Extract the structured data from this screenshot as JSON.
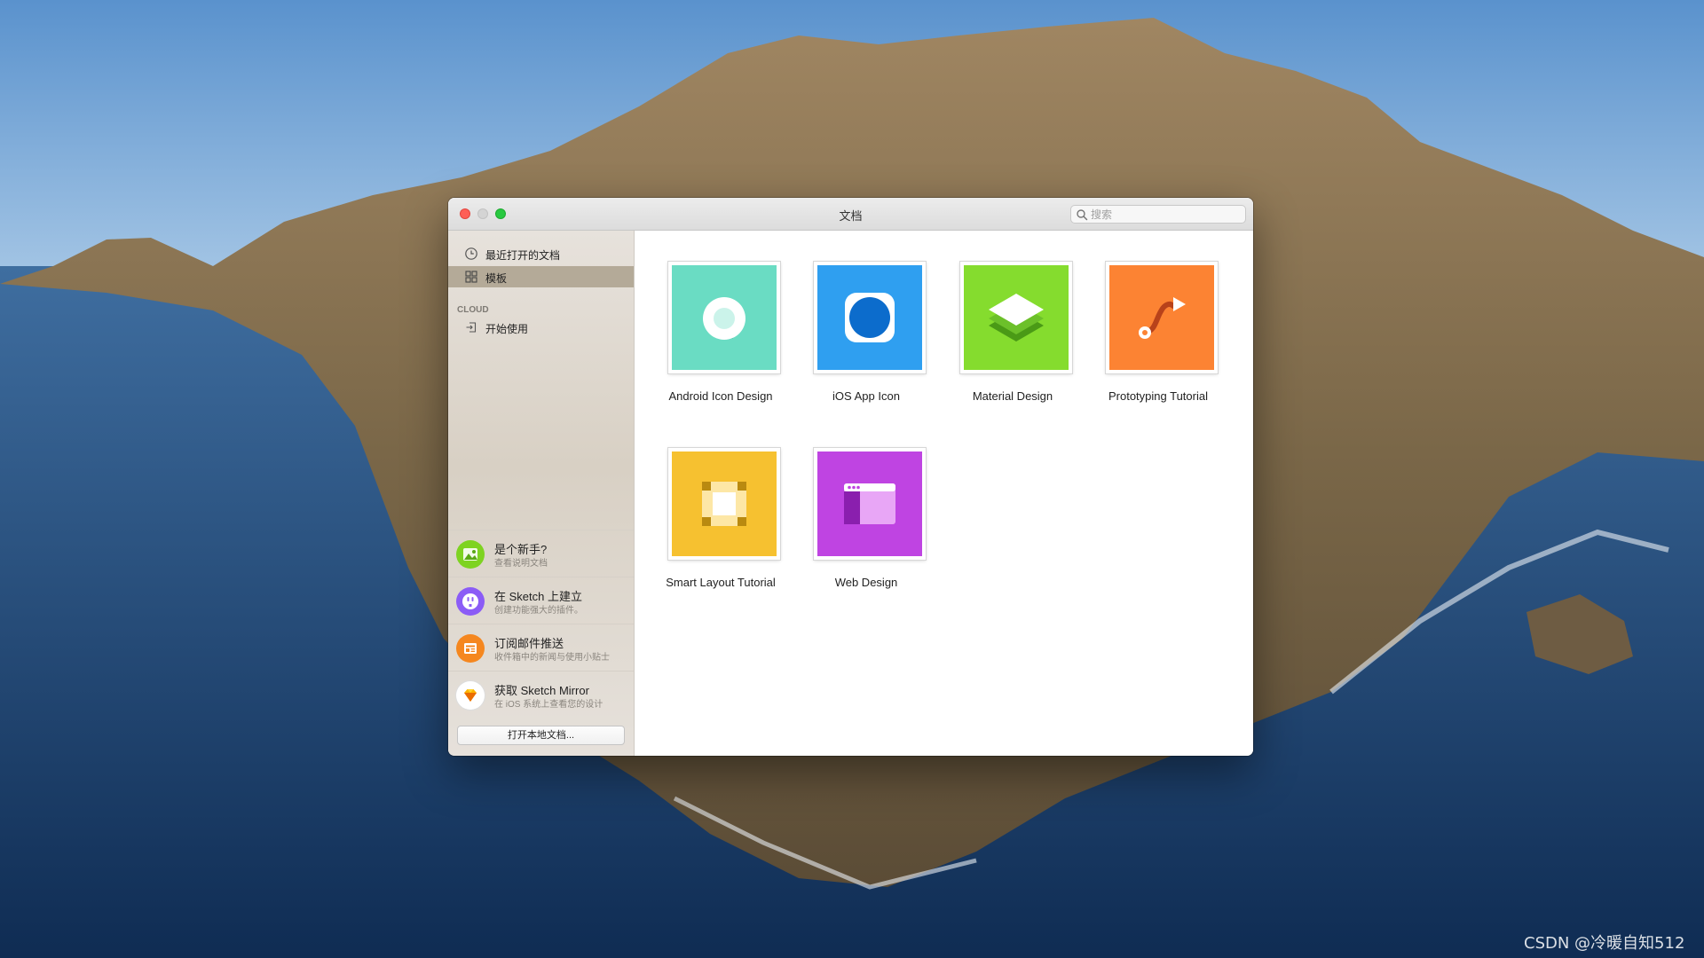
{
  "window": {
    "title": "文档"
  },
  "search": {
    "placeholder": "搜索"
  },
  "sidebar": {
    "items": [
      {
        "label": "最近打开的文档",
        "icon": "clock-icon"
      },
      {
        "label": "模板",
        "icon": "grid-icon",
        "selected": true
      }
    ],
    "section_label": "CLOUD",
    "cloud_items": [
      {
        "label": "开始使用",
        "icon": "sign-in-icon"
      }
    ],
    "promos": [
      {
        "title": "是个新手?",
        "subtitle": "查看说明文档",
        "icon": "landscape-icon",
        "color": "#7ed321"
      },
      {
        "title": "在 Sketch 上建立",
        "subtitle": "创建功能强大的插件。",
        "icon": "plugin-icon",
        "color": "#8b5cf6"
      },
      {
        "title": "订阅邮件推送",
        "subtitle": "收件箱中的新闻与使用小贴士",
        "icon": "newsletter-icon",
        "color": "#f5871f"
      },
      {
        "title": "获取 Sketch Mirror",
        "subtitle": "在 iOS 系统上查看您的设计",
        "icon": "sketch-diamond-icon",
        "color": "#fdb300"
      }
    ],
    "open_local_label": "打开本地文档..."
  },
  "templates": [
    {
      "label": "Android Icon Design",
      "color": "#6adcc3",
      "icon": "android-icon-design-thumbnail"
    },
    {
      "label": "iOS App Icon",
      "color": "#2f9ff0",
      "icon": "ios-app-icon-thumbnail"
    },
    {
      "label": "Material Design",
      "color": "#85dc2e",
      "icon": "material-layers-thumbnail"
    },
    {
      "label": "Prototyping Tutorial",
      "color": "#fc8333",
      "icon": "prototyping-path-thumbnail"
    },
    {
      "label": "Smart Layout Tutorial",
      "color": "#f6c130",
      "icon": "smart-layout-thumbnail"
    },
    {
      "label": "Web Design",
      "color": "#bf44e2",
      "icon": "web-browser-thumbnail"
    }
  ],
  "watermark": "CSDN @冷暖自知512"
}
